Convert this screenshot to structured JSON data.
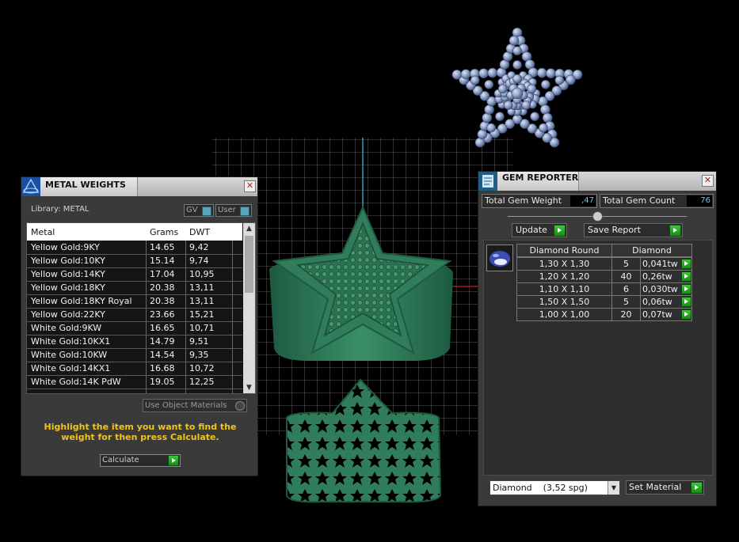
{
  "metal_weights": {
    "title": "METAL WEIGHTS",
    "library": "Library: METAL",
    "toggle_gv": "GV",
    "toggle_user": "User",
    "columns": [
      "Metal",
      "Grams",
      "DWT"
    ],
    "rows": [
      {
        "metal": "Yellow Gold:9KY",
        "grams": "14.65",
        "dwt": "9,42"
      },
      {
        "metal": "Yellow Gold:10KY",
        "grams": "15.14",
        "dwt": "9,74"
      },
      {
        "metal": "Yellow Gold:14KY",
        "grams": "17.04",
        "dwt": "10,95"
      },
      {
        "metal": "Yellow Gold:18KY",
        "grams": "20.38",
        "dwt": "13,11"
      },
      {
        "metal": "Yellow Gold:18KY Royal",
        "grams": "20.38",
        "dwt": "13,11"
      },
      {
        "metal": "Yellow Gold:22KY",
        "grams": "23.66",
        "dwt": "15,21"
      },
      {
        "metal": "White Gold:9KW",
        "grams": "16.65",
        "dwt": "10,71"
      },
      {
        "metal": "White Gold:10KX1",
        "grams": "14.79",
        "dwt": "9,51"
      },
      {
        "metal": "White Gold:10KW",
        "grams": "14.54",
        "dwt": "9,35"
      },
      {
        "metal": "White Gold:14KX1",
        "grams": "16.68",
        "dwt": "10,72"
      },
      {
        "metal": "White Gold:14K PdW",
        "grams": "19.05",
        "dwt": "12,25"
      }
    ],
    "use_object_materials": "Use Object Materials",
    "hint": "Highlight the item you want to find the weight for then press Calculate.",
    "calculate": "Calculate"
  },
  "gem_reporter": {
    "title": "GEM REPORTER",
    "total_weight_label": "Total Gem Weight",
    "total_weight_value": ",47",
    "total_count_label": "Total Gem Count",
    "total_count_value": "76",
    "update": "Update",
    "save_report": "Save Report",
    "table_headers": [
      "Diamond Round",
      "Diamond"
    ],
    "rows": [
      {
        "size": "1,30 X 1,30",
        "count": "5",
        "weight": "0,041tw"
      },
      {
        "size": "1,20 X 1,20",
        "count": "40",
        "weight": "0,26tw"
      },
      {
        "size": "1,10 X 1,10",
        "count": "6",
        "weight": "0,030tw"
      },
      {
        "size": "1,50 X 1,50",
        "count": "5",
        "weight": "0,06tw"
      },
      {
        "size": "1,00 X 1,00",
        "count": "20",
        "weight": "0,07tw"
      }
    ],
    "material_select": "Diamond    (3,52 spg)",
    "set_material": "Set Material"
  },
  "colors": {
    "ring": "#2f7a5a",
    "grid": "#555555",
    "accent_green": "#22a022",
    "hint_yellow": "#f0c419",
    "value_cyan": "#5ed0e8"
  }
}
